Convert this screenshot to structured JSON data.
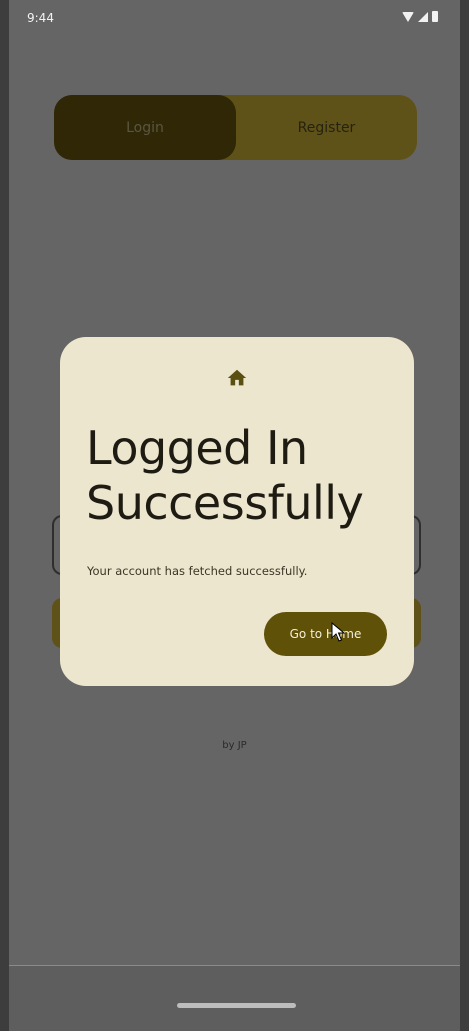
{
  "status": {
    "time": "9:44"
  },
  "tabs": {
    "login": "Login",
    "register": "Register"
  },
  "footer": {
    "credit": "by JP"
  },
  "dialog": {
    "icon": "home-icon",
    "title_line1": "Logged In",
    "title_line2": "Successfully",
    "message": "Your account has fetched successfully.",
    "button_label": "Go to Home"
  },
  "colors": {
    "accent": "#5f5107",
    "dialog_bg": "#ede6cf",
    "scrim": "#656565"
  }
}
